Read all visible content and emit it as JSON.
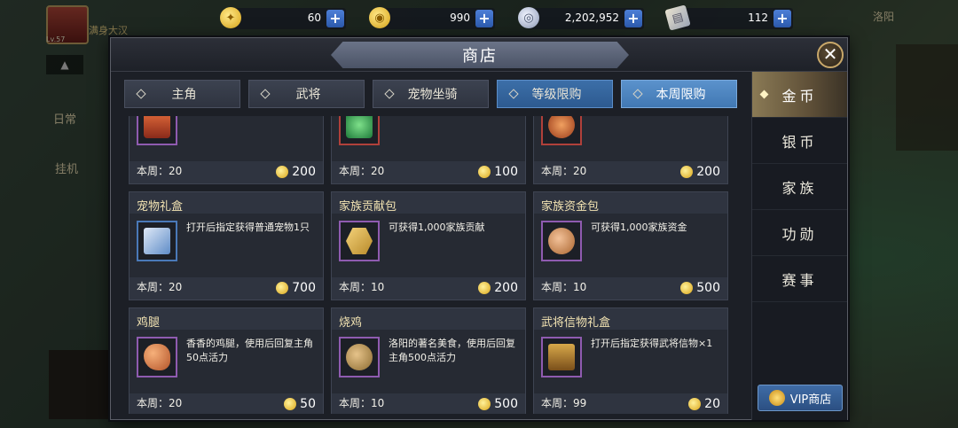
{
  "resources": [
    {
      "icon": "gold-coin-icon",
      "value": "60"
    },
    {
      "icon": "gold-ingot-icon",
      "value": "990"
    },
    {
      "icon": "silver-coin-icon",
      "value": "2,202,952"
    },
    {
      "icon": "scroll-icon",
      "value": "112"
    }
  ],
  "hud": {
    "player_name": "满身大汉",
    "level": "Lv.57",
    "daily": "日常",
    "afk": "挂机",
    "city": "洛阳"
  },
  "shop": {
    "title": "商店",
    "tabs": [
      "主角",
      "武将",
      "宠物坐骑",
      "等级限购",
      "本周限购"
    ],
    "categories": [
      "金币",
      "银币",
      "家族",
      "功勋",
      "赛事"
    ],
    "vip_label": "VIP商店",
    "items": [
      {
        "name": "",
        "desc": "",
        "limit": "本周：20",
        "price": "200",
        "icon": "red-box-icon"
      },
      {
        "name": "",
        "desc": "",
        "limit": "本周：20",
        "price": "100",
        "icon": "jade-icon"
      },
      {
        "name": "",
        "desc": "",
        "limit": "本周：20",
        "price": "200",
        "icon": "orange-orb-icon"
      },
      {
        "name": "宠物礼盒",
        "desc": "打开后指定获得普通宠物1只",
        "limit": "本周：20",
        "price": "700",
        "icon": "pet-gift-box-icon"
      },
      {
        "name": "家族贡献包",
        "desc": "可获得1,000家族贡献",
        "limit": "本周：10",
        "price": "200",
        "icon": "contribution-token-icon"
      },
      {
        "name": "家族资金包",
        "desc": "可获得1,000家族资金",
        "limit": "本周：10",
        "price": "500",
        "icon": "copper-coin-icon"
      },
      {
        "name": "鸡腿",
        "desc": "香香的鸡腿，使用后回复主角50点活力",
        "limit": "本周：20",
        "price": "50",
        "icon": "chicken-leg-icon"
      },
      {
        "name": "烧鸡",
        "desc": "洛阳的著名美食，使用后回复主角500点活力",
        "limit": "本周：10",
        "price": "500",
        "icon": "roast-chicken-icon"
      },
      {
        "name": "武将信物礼盒",
        "desc": "打开后指定获得武将信物×1",
        "limit": "本周：99",
        "price": "20",
        "icon": "treasure-chest-icon"
      }
    ]
  }
}
